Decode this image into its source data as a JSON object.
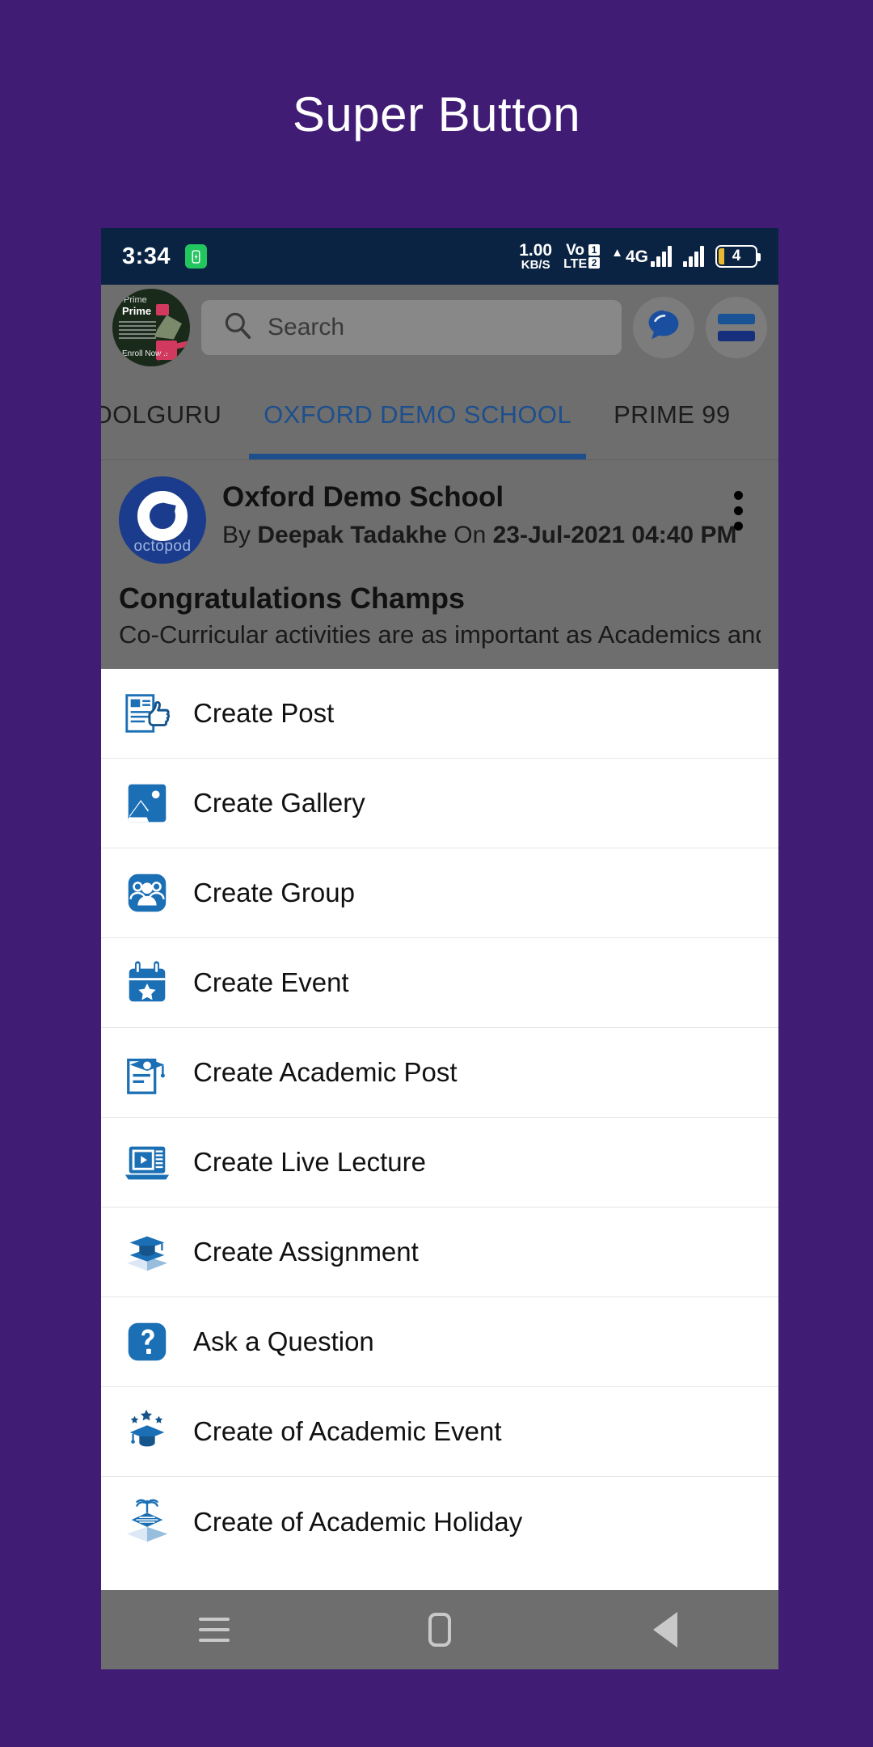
{
  "page": {
    "title": "Super Button",
    "background_color": "#411C74"
  },
  "status_bar": {
    "time": "3:34",
    "battery_charging_icon": "battery-charging-icon",
    "data_rate_value": "1.00",
    "data_rate_unit": "KB/S",
    "volte_top": "Vo",
    "volte_bottom": "LTE",
    "sim1": "1",
    "sim2": "2",
    "network_type": "4G",
    "battery_level": "4",
    "background_color": "#0A2342"
  },
  "toolbar": {
    "avatar_label": "Prime",
    "avatar_footer": "Enroll Now !!",
    "search_placeholder": "Search",
    "search_icon": "search-icon",
    "chat_icon": "chat-bubble-icon",
    "menu_icon": "hamburger-menu-icon"
  },
  "tabs": [
    {
      "label": "CHOOLGURU",
      "active": false
    },
    {
      "label": "OXFORD DEMO SCHOOL",
      "active": true
    },
    {
      "label": "PRIME 99",
      "active": false
    }
  ],
  "active_tab_color": "#1D4F8C",
  "post": {
    "logo_text": "octopod",
    "school_name": "Oxford Demo School",
    "byline_prefix": "By ",
    "author": "Deepak Tadakhe",
    "byline_mid": " On ",
    "datetime": "23-Jul-2021 04:40 PM",
    "headline": "Congratulations Champs",
    "body": "Co-Curricular activities are as important as Academics and we",
    "more_icon": "overflow-menu-icon"
  },
  "super_button_menu": {
    "items": [
      {
        "label": "Create Post",
        "icon": "create-post-icon"
      },
      {
        "label": "Create Gallery",
        "icon": "create-gallery-icon"
      },
      {
        "label": "Create Group",
        "icon": "create-group-icon"
      },
      {
        "label": "Create Event",
        "icon": "create-event-icon"
      },
      {
        "label": "Create Academic Post",
        "icon": "create-academic-post-icon"
      },
      {
        "label": "Create Live Lecture",
        "icon": "create-live-lecture-icon"
      },
      {
        "label": "Create Assignment",
        "icon": "create-assignment-icon"
      },
      {
        "label": "Ask a Question",
        "icon": "ask-a-question-icon"
      },
      {
        "label": "Create of Academic Event",
        "icon": "create-academic-event-icon"
      },
      {
        "label": "Create of Academic Holiday",
        "icon": "create-academic-holiday-icon"
      }
    ],
    "icon_color": "#1B6FB5",
    "icon_color_dark": "#15558C"
  },
  "nav_bar": {
    "recents_icon": "recents-icon",
    "home_icon": "home-icon",
    "back_icon": "back-icon"
  }
}
